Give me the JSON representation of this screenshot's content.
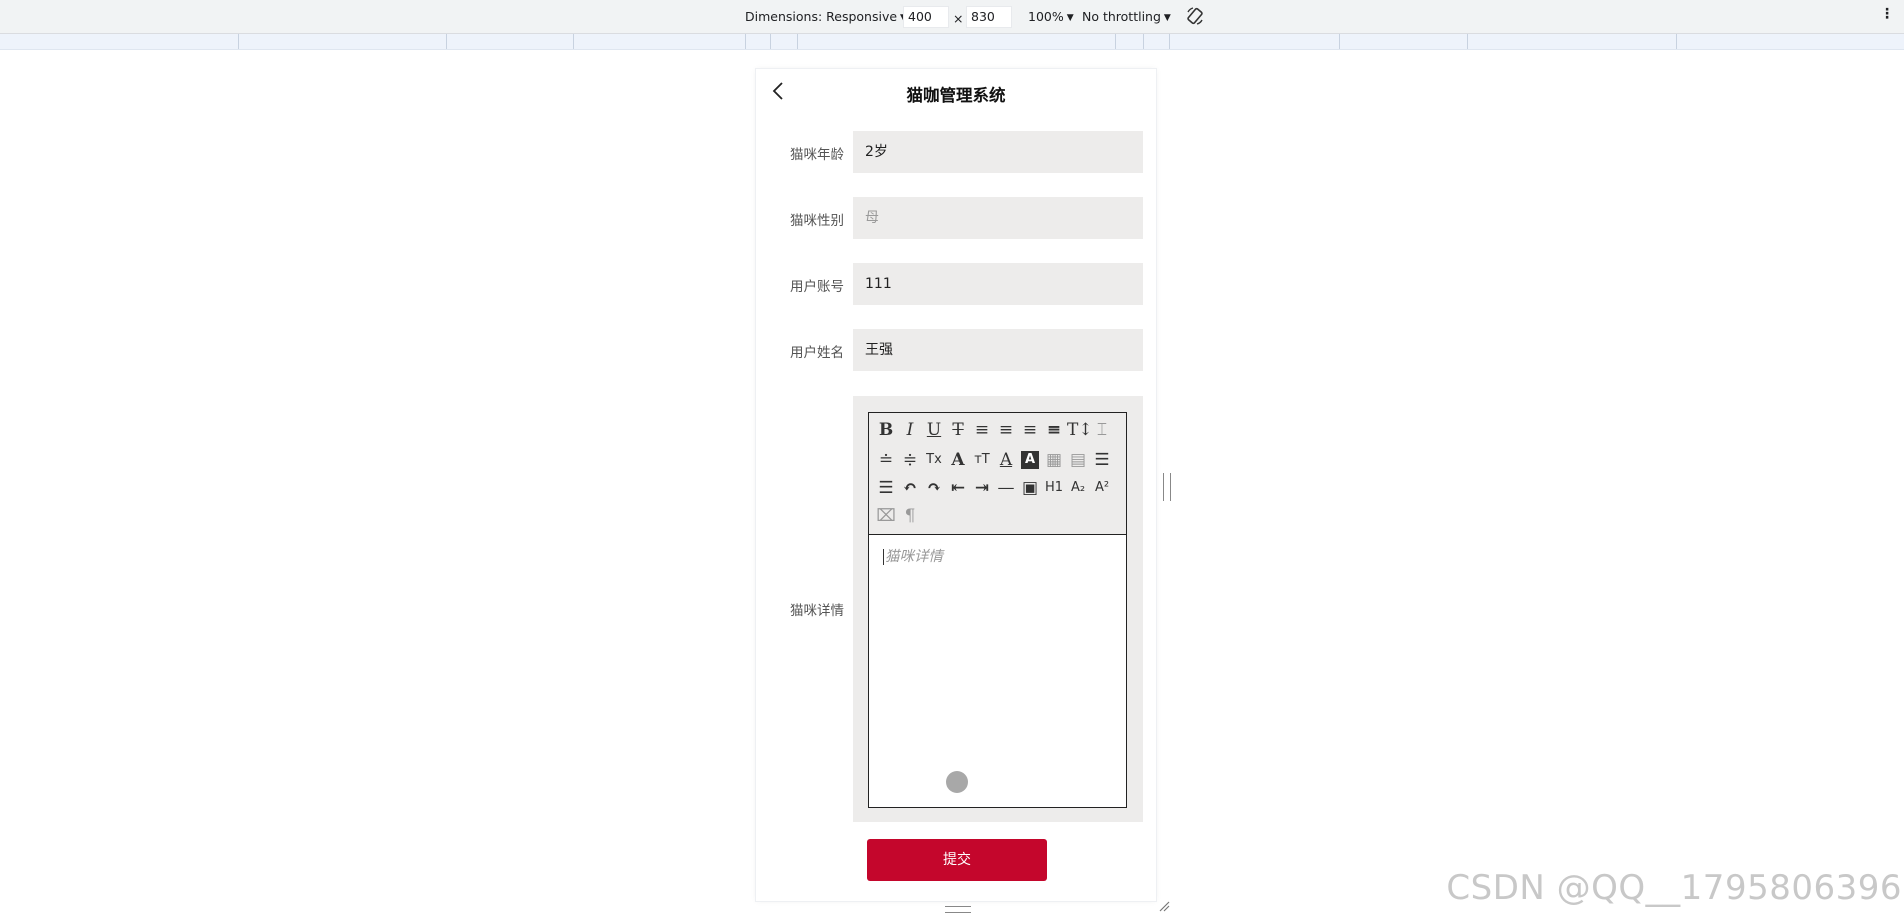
{
  "devtools": {
    "dimensions_label": "Dimensions: Responsive",
    "width_value": "400",
    "times": "×",
    "height_value": "830",
    "zoom": "100%",
    "throttling": "No throttling",
    "icons": [
      "rotate-icon",
      "more-options-icon"
    ]
  },
  "app": {
    "title": "猫咖管理系统",
    "back_icon": "chevron-left-icon"
  },
  "form": {
    "fields": [
      {
        "label": "猫咪年龄",
        "value": "2岁",
        "is_placeholder": false
      },
      {
        "label": "猫咪性别",
        "value": "母",
        "is_placeholder": true
      },
      {
        "label": "用户账号",
        "value": "111",
        "is_placeholder": false
      },
      {
        "label": "用户姓名",
        "value": "王强",
        "is_placeholder": false
      }
    ],
    "details_label": "猫咪详情",
    "details_placeholder": "猫咪详情",
    "submit_label": "提交"
  },
  "editor_toolbar": [
    "bold-icon",
    "italic-icon",
    "underline-icon",
    "strikethrough-icon",
    "align-left-icon",
    "align-center-icon",
    "align-right-icon",
    "align-justify-icon",
    "font-size-icon",
    "line-height-icon",
    "indent-before-icon",
    "indent-after-icon",
    "clear-format-icon",
    "font-family-icon",
    "text-size-icon",
    "font-color-icon",
    "background-color-icon",
    "insert-date-icon",
    "paste-plain-icon",
    "ordered-list-icon",
    "unordered-list-icon",
    "undo-icon",
    "redo-icon",
    "outdent-icon",
    "indent-icon",
    "horizontal-rule-icon",
    "image-icon",
    "heading-icon",
    "subscript-icon",
    "superscript-icon",
    "delete-icon",
    "paragraph-icon"
  ],
  "watermark": "CSDN @QQ__1795806396"
}
